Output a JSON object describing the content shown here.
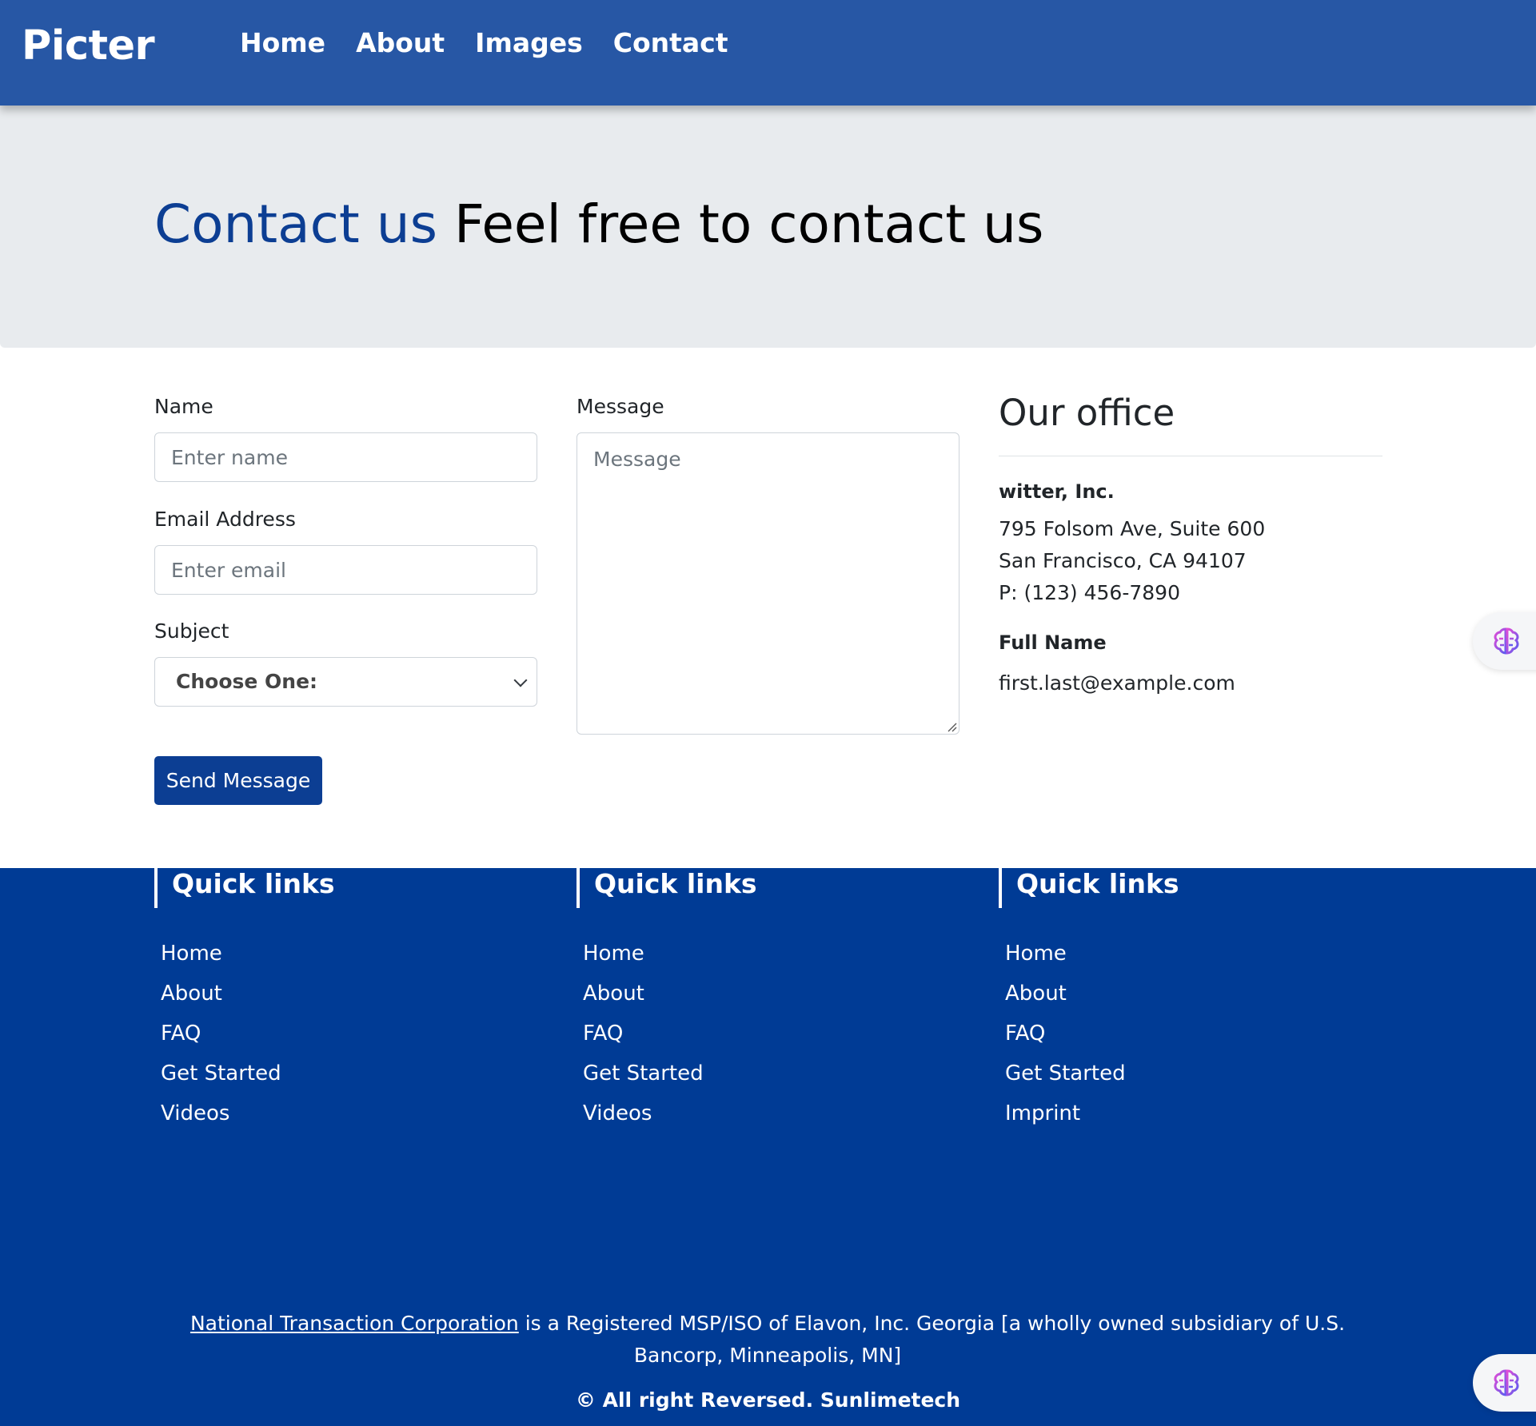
{
  "navbar": {
    "brand": "Picter",
    "links": [
      "Home",
      "About",
      "Images",
      "Contact"
    ]
  },
  "hero": {
    "title_accent": "Contact us",
    "title_rest": "Feel free to contact us"
  },
  "form": {
    "name_label": "Name",
    "name_placeholder": "Enter name",
    "email_label": "Email Address",
    "email_placeholder": "Enter email",
    "subject_label": "Subject",
    "subject_value": "Choose One:",
    "message_label": "Message",
    "message_placeholder": "Message",
    "send_label": "Send Message"
  },
  "office": {
    "title": "Our office",
    "company": "witter, Inc.",
    "address_line1": "795 Folsom Ave, Suite 600",
    "address_line2": "San Francisco, CA 94107",
    "phone": "P: (123) 456-7890",
    "contact_name": "Full Name",
    "contact_email": "first.last@example.com"
  },
  "footer": {
    "columns": [
      {
        "title": "Quick links",
        "links": [
          "Home",
          "About",
          "FAQ",
          "Get Started",
          "Videos"
        ]
      },
      {
        "title": "Quick links",
        "links": [
          "Home",
          "About",
          "FAQ",
          "Get Started",
          "Videos"
        ]
      },
      {
        "title": "Quick links",
        "links": [
          "Home",
          "About",
          "FAQ",
          "Get Started",
          "Imprint"
        ]
      }
    ],
    "legal_link": "National Transaction Corporation",
    "legal_text": " is a Registered MSP/ISO of Elavon, Inc. Georgia [a wholly owned subsidiary of U.S. Bancorp, Minneapolis, MN]",
    "copyright": "© All right Reversed.  Sunlimetech"
  },
  "widget": {
    "icon": "brain-icon"
  }
}
